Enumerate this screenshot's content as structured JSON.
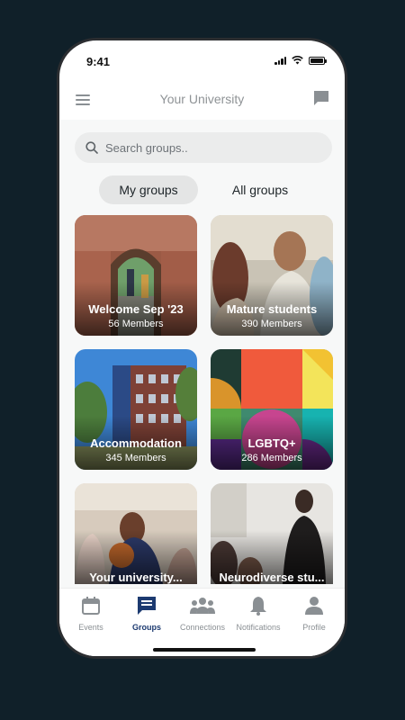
{
  "status": {
    "time": "9:41"
  },
  "header": {
    "title": "Your University",
    "menu_icon": "hamburger-menu-icon",
    "chat_icon": "chat-bubble-icon"
  },
  "search": {
    "placeholder": "Search groups..",
    "value": ""
  },
  "segments": [
    {
      "label": "My groups",
      "active": true
    },
    {
      "label": "All groups",
      "active": false
    }
  ],
  "groups": [
    {
      "name": "Welcome Sep '23",
      "members": "56 Members"
    },
    {
      "name": "Mature students",
      "members": "390 Members"
    },
    {
      "name": "Accommodation",
      "members": "345 Members"
    },
    {
      "name": "LGBTQ+",
      "members": "286 Members"
    },
    {
      "name": "Your university...",
      "members": ""
    },
    {
      "name": "Neurodiverse stu...",
      "members": ""
    }
  ],
  "tabs": [
    {
      "label": "Events",
      "icon": "calendar-icon"
    },
    {
      "label": "Groups",
      "icon": "groups-chat-icon",
      "active": true
    },
    {
      "label": "Connections",
      "icon": "people-icon"
    },
    {
      "label": "Notifications",
      "icon": "bell-icon"
    },
    {
      "label": "Profile",
      "icon": "profile-icon"
    }
  ],
  "colors": {
    "accent": "#1c3a70",
    "background": "#102029",
    "muted": "#8a8f93"
  }
}
